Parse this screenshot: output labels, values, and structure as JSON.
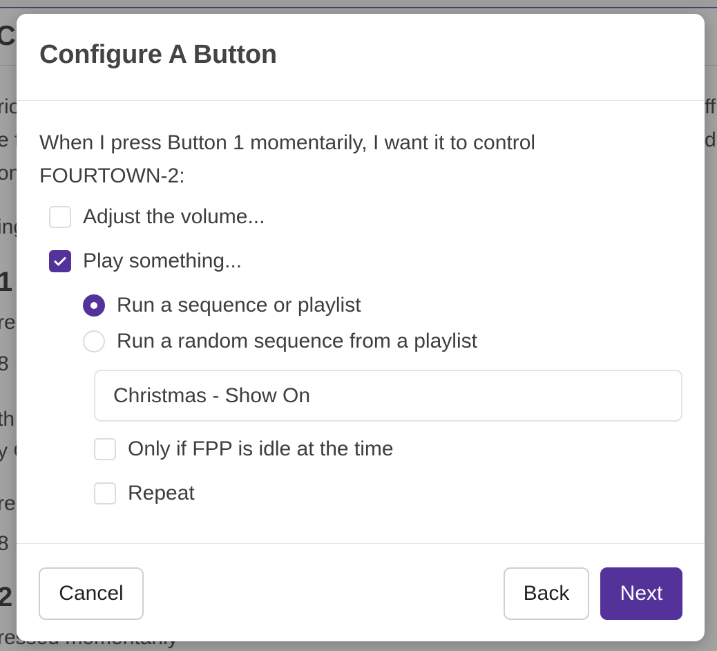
{
  "background": {
    "fragments": [
      "Co",
      "rio",
      "e f",
      "on",
      "ing",
      "1",
      "re",
      "8",
      "th",
      "y C",
      "re",
      "8",
      "2",
      "ressed momentarily",
      "ff",
      "d"
    ]
  },
  "dialog": {
    "title": "Configure A Button",
    "description": "When I press Button 1 momentarily, I want it to control FOURTOWN-2:",
    "options": {
      "adjust_volume": {
        "label": "Adjust the volume...",
        "checked": false
      },
      "play_something": {
        "label": "Play something...",
        "checked": true
      }
    },
    "play_mode": {
      "run_sequence": {
        "label": "Run a sequence or playlist",
        "selected": true
      },
      "run_random": {
        "label": "Run a random sequence from a playlist",
        "selected": false
      }
    },
    "selected_item": "Christmas - Show On",
    "only_if_idle": {
      "label": "Only if FPP is idle at the time",
      "checked": false
    },
    "repeat": {
      "label": "Repeat",
      "checked": false
    },
    "buttons": {
      "cancel": "Cancel",
      "back": "Back",
      "next": "Next"
    }
  },
  "colors": {
    "accent": "#53329a",
    "overlay": "#a3a3a3"
  }
}
